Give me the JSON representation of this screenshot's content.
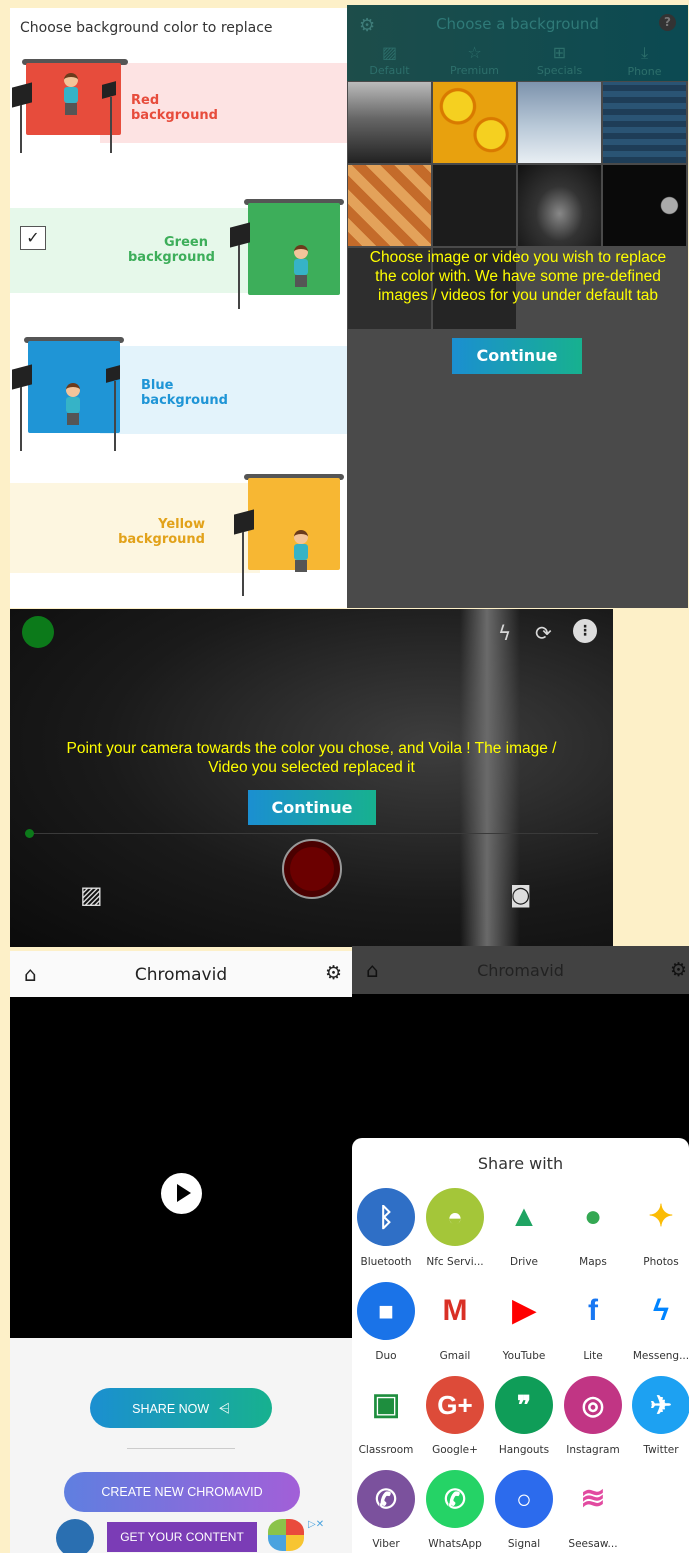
{
  "panel1": {
    "heading": "Choose background color to replace",
    "options": [
      {
        "label_line1": "Red",
        "label_line2": "background",
        "color": "#e74c3c",
        "row_bg": "#fde3e3",
        "label_color": "#e74c3c"
      },
      {
        "label_line1": "Green",
        "label_line2": "background",
        "color": "#3dae5a",
        "row_bg": "#e6f8ea",
        "label_color": "#3dae5a",
        "checked": true
      },
      {
        "label_line1": "Blue",
        "label_line2": "background",
        "color": "#1f95d6",
        "row_bg": "#e3f3fb",
        "label_color": "#1f95d6"
      },
      {
        "label_line1": "Yellow",
        "label_line2": "background",
        "color": "#f7b733",
        "row_bg": "#fdf6e0",
        "label_color": "#e2a21a"
      }
    ],
    "checkbox_glyph": "✓"
  },
  "panel2": {
    "title": "Choose a background",
    "tabs": [
      {
        "label": "Default",
        "icon": "image-icon"
      },
      {
        "label": "Premium",
        "icon": "star-icon"
      },
      {
        "label": "Specials",
        "icon": "gift-icon"
      },
      {
        "label": "Phone",
        "icon": "download-icon"
      }
    ],
    "help_glyph": "?",
    "overlay_text": "Choose image or video you wish to replace the color with. We have some pre-defined images / videos for you under default tab",
    "continue_label": "Continue"
  },
  "panel3": {
    "overlay_text": "Point your camera towards the color you chose, and Voila ! The image / Video you selected replaced it",
    "continue_label": "Continue"
  },
  "panel4": {
    "app_title": "Chromavid",
    "share_label": "SHARE NOW",
    "create_label": "CREATE NEW CHROMAVID",
    "ad_button_label": "GET YOUR CONTENT"
  },
  "panel5": {
    "app_title": "Chromavid",
    "sheet_title": "Share with",
    "apps": [
      {
        "name": "Bluetooth",
        "color": "#2f6fc6",
        "glyph": "ᛒ",
        "icon": "bluetooth-icon"
      },
      {
        "name": "Nfc Servi...",
        "color": "#a4c639",
        "glyph": "◓",
        "icon": "android-icon"
      },
      {
        "name": "Drive",
        "color": "#ffffff",
        "glyph": "▲",
        "icon": "drive-icon"
      },
      {
        "name": "Maps",
        "color": "#ffffff",
        "glyph": "●",
        "icon": "maps-pin-icon"
      },
      {
        "name": "Photos",
        "color": "#ffffff",
        "glyph": "✦",
        "icon": "photos-pinwheel-icon"
      },
      {
        "name": "Duo",
        "color": "#1a73e8",
        "glyph": "■",
        "icon": "duo-icon"
      },
      {
        "name": "Gmail",
        "color": "#ffffff",
        "glyph": "M",
        "icon": "gmail-icon"
      },
      {
        "name": "YouTube",
        "color": "#ffffff",
        "glyph": "▶",
        "icon": "youtube-icon"
      },
      {
        "name": "Lite",
        "color": "#ffffff",
        "glyph": "f",
        "icon": "facebook-lite-icon"
      },
      {
        "name": "Messeng...",
        "color": "#ffffff",
        "glyph": "ϟ",
        "icon": "messenger-icon"
      },
      {
        "name": "Classroom",
        "color": "#ffffff",
        "glyph": "▣",
        "icon": "classroom-icon"
      },
      {
        "name": "Google+",
        "color": "#dd4b39",
        "glyph": "G+",
        "icon": "google-plus-icon"
      },
      {
        "name": "Hangouts",
        "color": "#0f9d58",
        "glyph": "❞",
        "icon": "hangouts-icon"
      },
      {
        "name": "Instagram",
        "color": "#c13584",
        "glyph": "◎",
        "icon": "instagram-icon"
      },
      {
        "name": "Twitter",
        "color": "#1da1f2",
        "glyph": "✈",
        "icon": "twitter-icon"
      },
      {
        "name": "Viber",
        "color": "#7b519d",
        "glyph": "✆",
        "icon": "viber-icon"
      },
      {
        "name": "WhatsApp",
        "color": "#25d366",
        "glyph": "✆",
        "icon": "whatsapp-icon"
      },
      {
        "name": "Signal",
        "color": "#2c6bed",
        "glyph": "○",
        "icon": "signal-icon"
      },
      {
        "name": "Seesaw...",
        "color": "#ffffff",
        "glyph": "≋",
        "icon": "seesaw-icon"
      }
    ]
  }
}
